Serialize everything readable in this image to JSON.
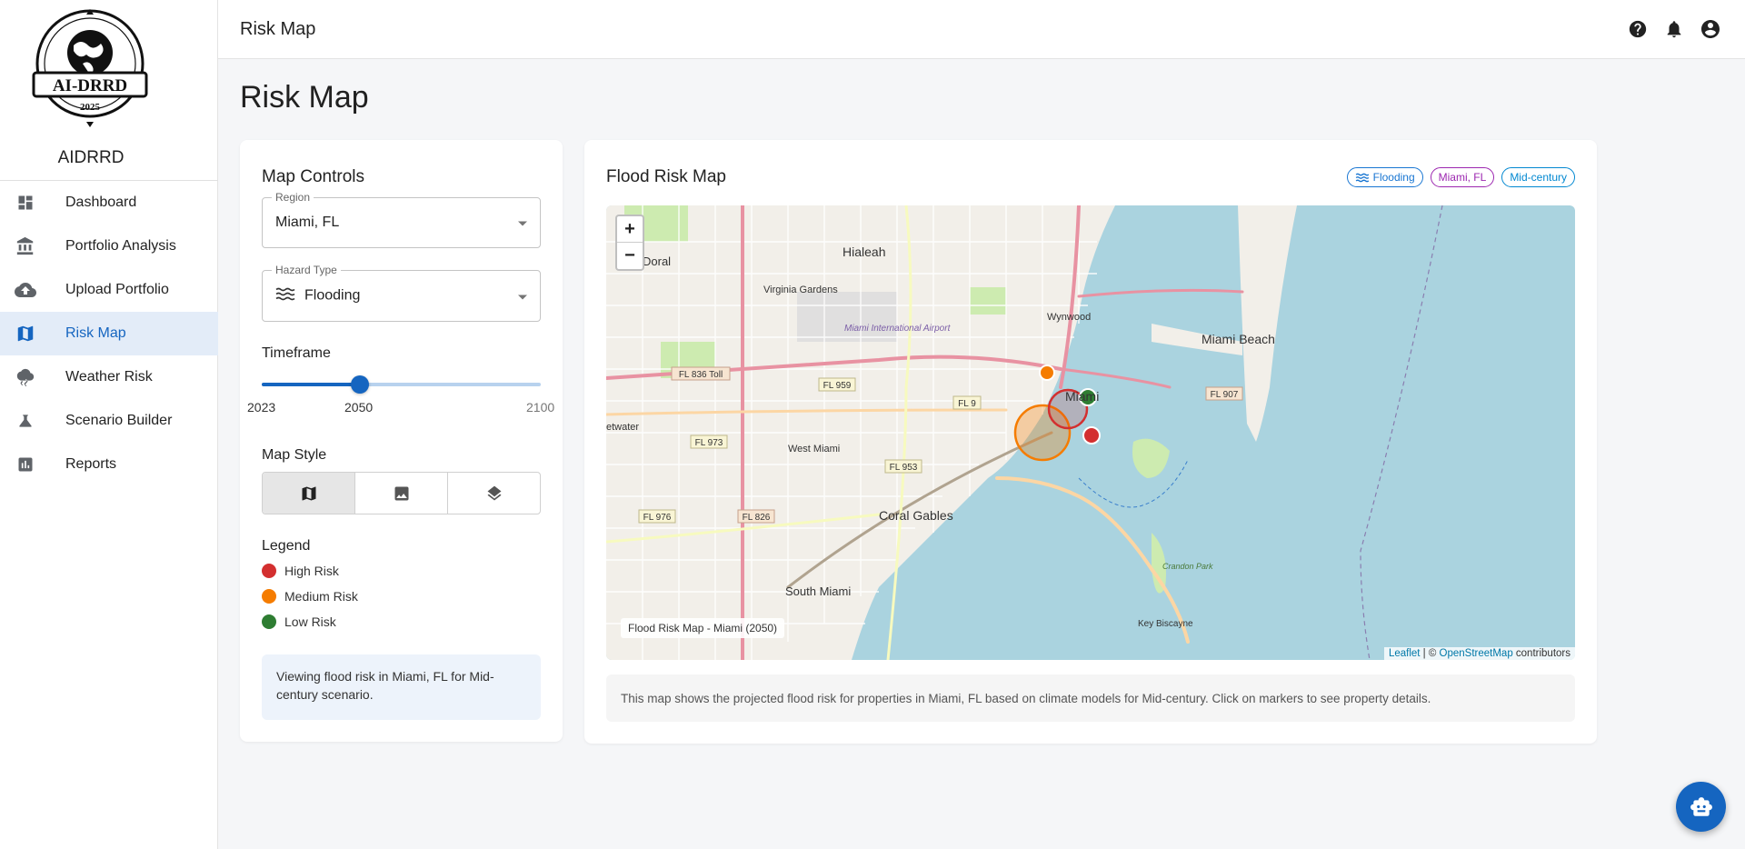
{
  "app": {
    "brand": "AIDRRD",
    "logo": {
      "main_text": "AI-DRRD",
      "year": "2025"
    }
  },
  "sidebar": {
    "items": [
      {
        "label": "Dashboard",
        "icon": "dashboard-icon"
      },
      {
        "label": "Portfolio Analysis",
        "icon": "bank-icon"
      },
      {
        "label": "Upload Portfolio",
        "icon": "cloud-upload-icon"
      },
      {
        "label": "Risk Map",
        "icon": "map-icon",
        "active": true
      },
      {
        "label": "Weather Risk",
        "icon": "thunderstorm-icon"
      },
      {
        "label": "Scenario Builder",
        "icon": "flask-icon"
      },
      {
        "label": "Reports",
        "icon": "bar-chart-icon"
      }
    ]
  },
  "topbar": {
    "title": "Risk Map",
    "icons": [
      "help-icon",
      "notifications-icon",
      "account-icon"
    ]
  },
  "page": {
    "title": "Risk Map"
  },
  "controls": {
    "title": "Map Controls",
    "region": {
      "label": "Region",
      "value": "Miami, FL"
    },
    "hazard": {
      "label": "Hazard Type",
      "value": "Flooding",
      "icon": "waves-icon"
    },
    "timeframe": {
      "label": "Timeframe",
      "min": "2023",
      "value": "2050",
      "max": "2100",
      "fraction": 0.351
    },
    "map_style": {
      "label": "Map Style",
      "options": [
        "map-icon",
        "image-icon",
        "layers-icon"
      ],
      "selected": 0
    },
    "legend": {
      "title": "Legend",
      "items": [
        {
          "label": "High Risk",
          "color": "#d32f2f"
        },
        {
          "label": "Medium Risk",
          "color": "#f57c00"
        },
        {
          "label": "Low Risk",
          "color": "#2e7d32"
        }
      ]
    },
    "info": "Viewing flood risk in Miami, FL for Mid-century scenario."
  },
  "map_card": {
    "title": "Flood Risk Map",
    "chips": [
      {
        "label": "Flooding",
        "color": "#1976d2",
        "icon": "waves-icon"
      },
      {
        "label": "Miami, FL",
        "color": "#9c27b0"
      },
      {
        "label": "Mid-century",
        "color": "#0288d1"
      }
    ],
    "zoom_in": "+",
    "zoom_out": "−",
    "caption": "Flood Risk Map - Miami (2050)",
    "attribution": {
      "leaflet": "Leaflet",
      "sep": " | © ",
      "osm": "OpenStreetMap",
      "suffix": " contributors"
    },
    "map_labels": {
      "doral": "Doral",
      "hialeah": "Hialeah",
      "virginia_gardens": "Virginia Gardens",
      "airport": "Miami International Airport",
      "wynwood": "Wynwood",
      "miami_beach": "Miami Beach",
      "miami": "Miami",
      "west_miami": "West Miami",
      "coral_gables": "Coral Gables",
      "south_miami": "South Miami",
      "key_biscayne": "Key Biscayne",
      "crandon_park": "Crandon Park",
      "sweetwater": "etwater",
      "fl836": "FL 836 Toll",
      "fl959": "FL 959",
      "fl9": "FL 9",
      "fl973": "FL 973",
      "fl953": "FL 953",
      "fl976": "FL 976",
      "fl826": "FL 826",
      "fl907": "FL 907"
    },
    "description": "This map shows the projected flood risk for properties in Miami, FL based on climate models for Mid-century. Click on markers to see property details."
  }
}
